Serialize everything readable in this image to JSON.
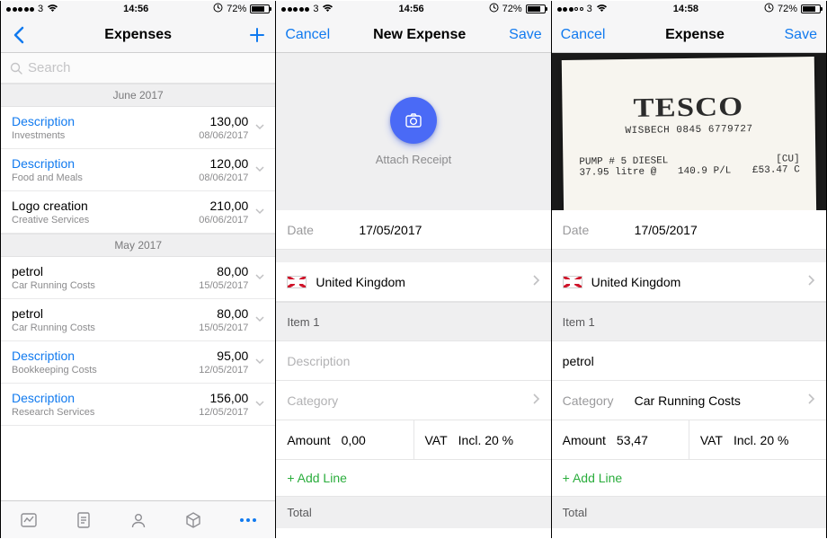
{
  "screen1": {
    "status": {
      "carrier": "3",
      "time": "14:56",
      "battery": "72%",
      "wifi": true,
      "signal": "full"
    },
    "nav": {
      "title": "Expenses"
    },
    "search": {
      "placeholder": "Search"
    },
    "sections": [
      {
        "title": "June 2017",
        "items": [
          {
            "desc": "Description",
            "link": true,
            "cat": "Investments",
            "amount": "130,00",
            "date": "08/06/2017"
          },
          {
            "desc": "Description",
            "link": true,
            "cat": "Food and Meals",
            "amount": "120,00",
            "date": "08/06/2017"
          },
          {
            "desc": "Logo creation",
            "link": false,
            "cat": "Creative Services",
            "amount": "210,00",
            "date": "06/06/2017"
          }
        ]
      },
      {
        "title": "May 2017",
        "items": [
          {
            "desc": "petrol",
            "link": false,
            "cat": "Car Running Costs",
            "amount": "80,00",
            "date": "15/05/2017"
          },
          {
            "desc": "petrol",
            "link": false,
            "cat": "Car Running Costs",
            "amount": "80,00",
            "date": "15/05/2017"
          },
          {
            "desc": "Description",
            "link": true,
            "cat": "Bookkeeping Costs",
            "amount": "95,00",
            "date": "12/05/2017"
          },
          {
            "desc": "Description",
            "link": true,
            "cat": "Research Services",
            "amount": "156,00",
            "date": "12/05/2017"
          }
        ]
      }
    ]
  },
  "screen2": {
    "status": {
      "carrier": "3",
      "time": "14:56",
      "battery": "72%"
    },
    "nav": {
      "cancel": "Cancel",
      "title": "New Expense",
      "save": "Save"
    },
    "attach": "Attach Receipt",
    "date_label": "Date",
    "date_value": "17/05/2017",
    "country": "United Kingdom",
    "item_header": "Item 1",
    "description_placeholder": "Description",
    "category_placeholder": "Category",
    "amount_label": "Amount",
    "amount_value": "0,00",
    "vat_label": "VAT",
    "vat_value": "Incl. 20 %",
    "add_line": "+ Add Line",
    "total_label": "Total"
  },
  "screen3": {
    "status": {
      "carrier": "3",
      "time": "14:58",
      "battery": "72%",
      "signal": "partial"
    },
    "nav": {
      "cancel": "Cancel",
      "title": "Expense",
      "save": "Save"
    },
    "receipt": {
      "store": "TESCO",
      "store_sub": "WISBECH 0845 6779727",
      "line1a": "PUMP # 5 DIESEL",
      "line1b": "[CU]",
      "line2a": "37.95 litre @",
      "line2b": "140.9 P/L",
      "line2c": "£53.47 C"
    },
    "date_label": "Date",
    "date_value": "17/05/2017",
    "country": "United Kingdom",
    "item_header": "Item 1",
    "description_value": "petrol",
    "category_label": "Category",
    "category_value": "Car Running Costs",
    "amount_label": "Amount",
    "amount_value": "53,47",
    "vat_label": "VAT",
    "vat_value": "Incl. 20 %",
    "add_line": "+ Add Line",
    "total_label": "Total"
  }
}
